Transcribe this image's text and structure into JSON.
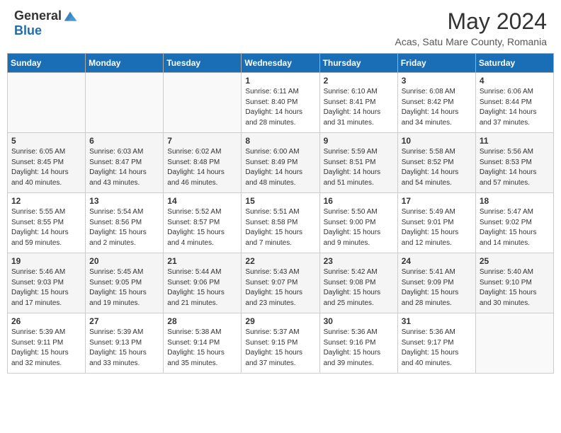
{
  "header": {
    "logo_general": "General",
    "logo_blue": "Blue",
    "title": "May 2024",
    "subtitle": "Acas, Satu Mare County, Romania"
  },
  "calendar": {
    "days_of_week": [
      "Sunday",
      "Monday",
      "Tuesday",
      "Wednesday",
      "Thursday",
      "Friday",
      "Saturday"
    ],
    "weeks": [
      [
        {
          "day": "",
          "info": ""
        },
        {
          "day": "",
          "info": ""
        },
        {
          "day": "",
          "info": ""
        },
        {
          "day": "1",
          "info": "Sunrise: 6:11 AM\nSunset: 8:40 PM\nDaylight: 14 hours and 28 minutes."
        },
        {
          "day": "2",
          "info": "Sunrise: 6:10 AM\nSunset: 8:41 PM\nDaylight: 14 hours and 31 minutes."
        },
        {
          "day": "3",
          "info": "Sunrise: 6:08 AM\nSunset: 8:42 PM\nDaylight: 14 hours and 34 minutes."
        },
        {
          "day": "4",
          "info": "Sunrise: 6:06 AM\nSunset: 8:44 PM\nDaylight: 14 hours and 37 minutes."
        }
      ],
      [
        {
          "day": "5",
          "info": "Sunrise: 6:05 AM\nSunset: 8:45 PM\nDaylight: 14 hours and 40 minutes."
        },
        {
          "day": "6",
          "info": "Sunrise: 6:03 AM\nSunset: 8:47 PM\nDaylight: 14 hours and 43 minutes."
        },
        {
          "day": "7",
          "info": "Sunrise: 6:02 AM\nSunset: 8:48 PM\nDaylight: 14 hours and 46 minutes."
        },
        {
          "day": "8",
          "info": "Sunrise: 6:00 AM\nSunset: 8:49 PM\nDaylight: 14 hours and 48 minutes."
        },
        {
          "day": "9",
          "info": "Sunrise: 5:59 AM\nSunset: 8:51 PM\nDaylight: 14 hours and 51 minutes."
        },
        {
          "day": "10",
          "info": "Sunrise: 5:58 AM\nSunset: 8:52 PM\nDaylight: 14 hours and 54 minutes."
        },
        {
          "day": "11",
          "info": "Sunrise: 5:56 AM\nSunset: 8:53 PM\nDaylight: 14 hours and 57 minutes."
        }
      ],
      [
        {
          "day": "12",
          "info": "Sunrise: 5:55 AM\nSunset: 8:55 PM\nDaylight: 14 hours and 59 minutes."
        },
        {
          "day": "13",
          "info": "Sunrise: 5:54 AM\nSunset: 8:56 PM\nDaylight: 15 hours and 2 minutes."
        },
        {
          "day": "14",
          "info": "Sunrise: 5:52 AM\nSunset: 8:57 PM\nDaylight: 15 hours and 4 minutes."
        },
        {
          "day": "15",
          "info": "Sunrise: 5:51 AM\nSunset: 8:58 PM\nDaylight: 15 hours and 7 minutes."
        },
        {
          "day": "16",
          "info": "Sunrise: 5:50 AM\nSunset: 9:00 PM\nDaylight: 15 hours and 9 minutes."
        },
        {
          "day": "17",
          "info": "Sunrise: 5:49 AM\nSunset: 9:01 PM\nDaylight: 15 hours and 12 minutes."
        },
        {
          "day": "18",
          "info": "Sunrise: 5:47 AM\nSunset: 9:02 PM\nDaylight: 15 hours and 14 minutes."
        }
      ],
      [
        {
          "day": "19",
          "info": "Sunrise: 5:46 AM\nSunset: 9:03 PM\nDaylight: 15 hours and 17 minutes."
        },
        {
          "day": "20",
          "info": "Sunrise: 5:45 AM\nSunset: 9:05 PM\nDaylight: 15 hours and 19 minutes."
        },
        {
          "day": "21",
          "info": "Sunrise: 5:44 AM\nSunset: 9:06 PM\nDaylight: 15 hours and 21 minutes."
        },
        {
          "day": "22",
          "info": "Sunrise: 5:43 AM\nSunset: 9:07 PM\nDaylight: 15 hours and 23 minutes."
        },
        {
          "day": "23",
          "info": "Sunrise: 5:42 AM\nSunset: 9:08 PM\nDaylight: 15 hours and 25 minutes."
        },
        {
          "day": "24",
          "info": "Sunrise: 5:41 AM\nSunset: 9:09 PM\nDaylight: 15 hours and 28 minutes."
        },
        {
          "day": "25",
          "info": "Sunrise: 5:40 AM\nSunset: 9:10 PM\nDaylight: 15 hours and 30 minutes."
        }
      ],
      [
        {
          "day": "26",
          "info": "Sunrise: 5:39 AM\nSunset: 9:11 PM\nDaylight: 15 hours and 32 minutes."
        },
        {
          "day": "27",
          "info": "Sunrise: 5:39 AM\nSunset: 9:13 PM\nDaylight: 15 hours and 33 minutes."
        },
        {
          "day": "28",
          "info": "Sunrise: 5:38 AM\nSunset: 9:14 PM\nDaylight: 15 hours and 35 minutes."
        },
        {
          "day": "29",
          "info": "Sunrise: 5:37 AM\nSunset: 9:15 PM\nDaylight: 15 hours and 37 minutes."
        },
        {
          "day": "30",
          "info": "Sunrise: 5:36 AM\nSunset: 9:16 PM\nDaylight: 15 hours and 39 minutes."
        },
        {
          "day": "31",
          "info": "Sunrise: 5:36 AM\nSunset: 9:17 PM\nDaylight: 15 hours and 40 minutes."
        },
        {
          "day": "",
          "info": ""
        }
      ]
    ]
  }
}
